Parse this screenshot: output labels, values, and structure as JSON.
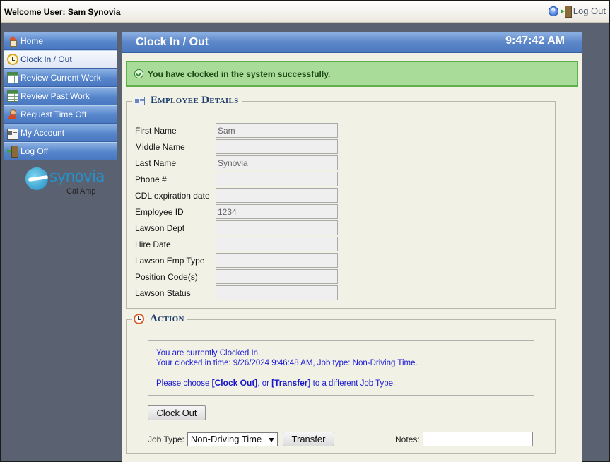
{
  "header": {
    "welcome": "Welcome User: Sam Synovia",
    "logout_label": "Log Out"
  },
  "sidebar": {
    "items": [
      {
        "label": "Home",
        "icon": "home-icon"
      },
      {
        "label": "Clock In / Out",
        "icon": "clock-icon",
        "active": true
      },
      {
        "label": "Review Current Work",
        "icon": "spreadsheet-icon"
      },
      {
        "label": "Review Past Work",
        "icon": "spreadsheet-icon"
      },
      {
        "label": "Request Time Off",
        "icon": "person-icon"
      },
      {
        "label": "My Account",
        "icon": "id-card-icon"
      },
      {
        "label": "Log Off",
        "icon": "door-exit-icon"
      }
    ],
    "brand": {
      "name": "synovia",
      "sub": "Cal Amp"
    }
  },
  "main": {
    "title": "Clock In / Out",
    "time": "9:47:42 AM",
    "success_message": "You have clocked in the system successfully.",
    "employee_details": {
      "legend": "Employee Details",
      "fields": [
        {
          "label": "First Name",
          "value": "Sam"
        },
        {
          "label": "Middle Name",
          "value": ""
        },
        {
          "label": "Last Name",
          "value": "Synovia"
        },
        {
          "label": "Phone #",
          "value": ""
        },
        {
          "label": "CDL expiration date",
          "value": ""
        },
        {
          "label": "Employee ID",
          "value": "1234"
        },
        {
          "label": "Lawson Dept",
          "value": ""
        },
        {
          "label": "Hire Date",
          "value": ""
        },
        {
          "label": "Lawson Emp Type",
          "value": ""
        },
        {
          "label": "Position Code(s)",
          "value": ""
        },
        {
          "label": "Lawson Status",
          "value": ""
        }
      ]
    },
    "action": {
      "legend": "Action",
      "status_line1": "You are currently Clocked In.",
      "status_line2": "Your clocked in time:  9/26/2024 9:46:48 AM, Job type: Non-Driving Time.",
      "choose_prefix": "Please choose ",
      "choose_clockout": "[Clock Out]",
      "choose_mid": ", or ",
      "choose_transfer": "[Transfer]",
      "choose_suffix": " to a different Job Type.",
      "clock_out_button": "Clock Out",
      "job_type_label": "Job Type:",
      "job_type_value": "Non-Driving Time",
      "transfer_button": "Transfer",
      "notes_label": "Notes:",
      "notes_value": ""
    }
  },
  "colors": {
    "nav_blue": "#5685cc",
    "success_bg": "#a8dc98",
    "link_blue": "#1a1ad4",
    "panel_bg": "#f2f1e6"
  }
}
